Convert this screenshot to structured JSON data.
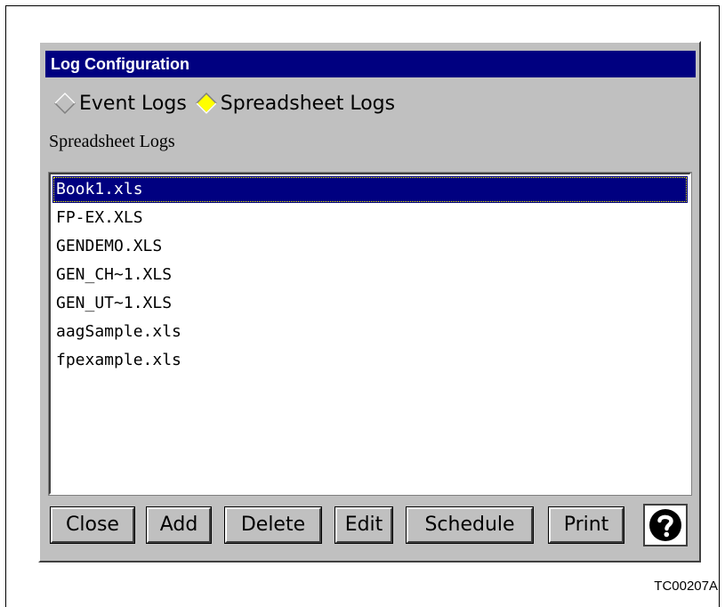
{
  "window": {
    "title": "Log Configuration"
  },
  "log_type": {
    "options": [
      {
        "label": "Event Logs",
        "selected": false
      },
      {
        "label": "Spreadsheet Logs",
        "selected": true
      }
    ]
  },
  "section_label": "Spreadsheet Logs",
  "files": [
    {
      "name": "Book1.xls",
      "selected": true
    },
    {
      "name": "FP-EX.XLS",
      "selected": false
    },
    {
      "name": "GENDEMO.XLS",
      "selected": false
    },
    {
      "name": "GEN_CH~1.XLS",
      "selected": false
    },
    {
      "name": "GEN_UT~1.XLS",
      "selected": false
    },
    {
      "name": "aagSample.xls",
      "selected": false
    },
    {
      "name": "fpexample.xls",
      "selected": false
    }
  ],
  "buttons": {
    "close": "Close",
    "add": "Add",
    "delete": "Delete",
    "edit": "Edit",
    "schedule": "Schedule",
    "print": "Print",
    "help_icon": "question-circle-icon"
  },
  "footer_code": "TC00207A",
  "colors": {
    "titlebar": "#000080",
    "selection": "#000080",
    "radio_selected": "#ffff00",
    "panel": "#c0c0c0"
  }
}
